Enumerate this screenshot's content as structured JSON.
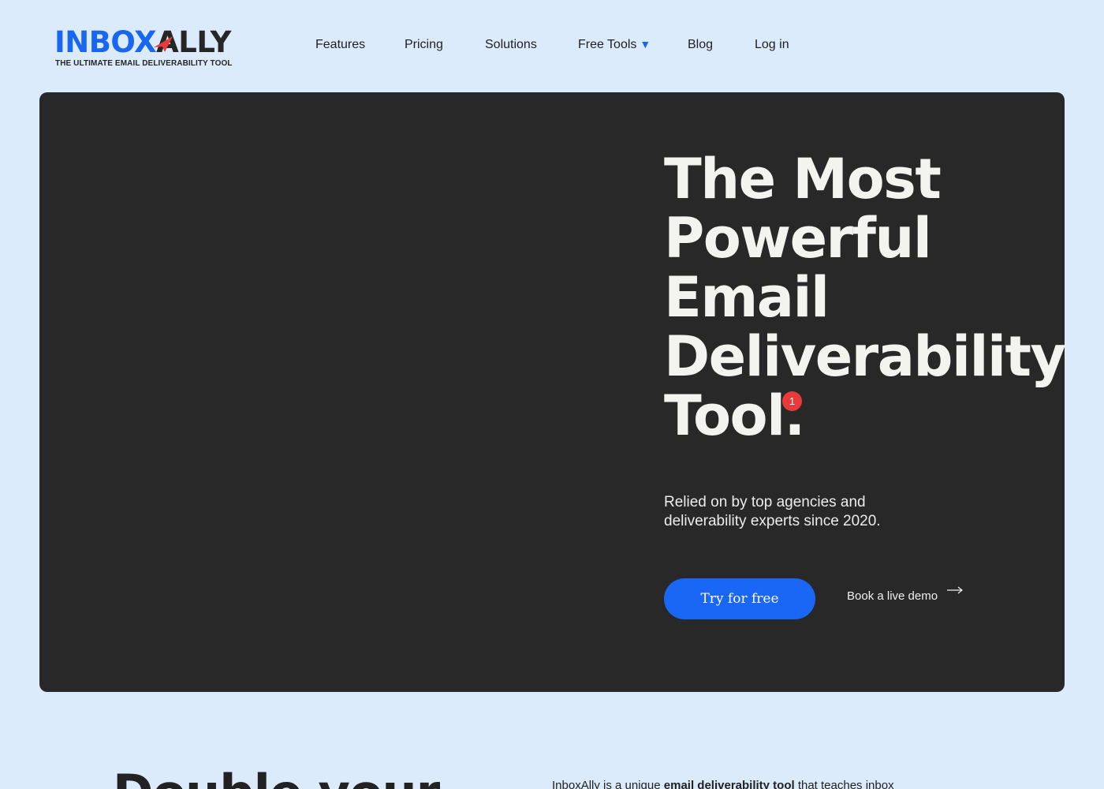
{
  "header": {
    "logo": {
      "word_part1": "INBOX",
      "word_part2": "ALLY",
      "tagline": "THE ULTIMATE EMAIL DELIVERABILITY TOOL"
    },
    "nav": {
      "features": "Features",
      "pricing": "Pricing",
      "solutions": "Solutions",
      "free_tools": "Free Tools",
      "free_tools_caret": "▼",
      "blog": "Blog",
      "login": "Log in"
    }
  },
  "hero": {
    "title_lines": [
      "The Most",
      "Powerful",
      "Email",
      "Deliverability",
      "Tool."
    ],
    "badge_count": "1",
    "subtitle_lines": [
      "Relied on by top agencies and",
      "deliverability experts since 2020."
    ],
    "cta_primary": "Try for free",
    "cta_secondary": "Book a live demo"
  },
  "section2": {
    "heading": "Double your",
    "text_before": "InboxAlly is a unique ",
    "text_bold": "email deliverability tool",
    "text_after": " that teaches inbox"
  },
  "colors": {
    "page_bg": "#dcebfc",
    "hero_bg": "#282829",
    "brand_blue": "#1966f0",
    "badge_red": "#e83a3a"
  },
  "icons": {
    "logo_plane": "paper-plane-icon",
    "dropdown": "chevron-down-icon",
    "demo_arrow": "arrow-right-icon"
  }
}
